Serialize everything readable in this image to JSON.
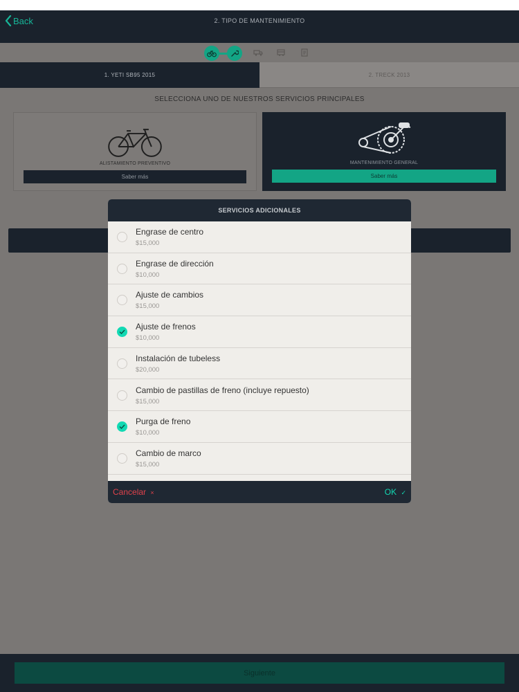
{
  "nav": {
    "back_label": "Back",
    "title": "2. TIPO DE MANTENIMIENTO"
  },
  "steps": {
    "icons": [
      "bike-icon",
      "wrench-icon",
      "truck-icon",
      "delivery-icon",
      "receipt-icon"
    ]
  },
  "bike_tabs": [
    {
      "label": "1. YETI SB95 2015",
      "active": true
    },
    {
      "label": "2. TRECK 2013",
      "active": false
    }
  ],
  "section_title": "SELECCIONA UNO DE NUESTROS SERVICIOS PRINCIPALES",
  "service_cards": [
    {
      "caption": "ALISTAMIENTO PREVENTIVO",
      "button": "Saber más",
      "selected": false
    },
    {
      "caption": "MANTENIMIENTO GENERAL",
      "button": "Saber más",
      "selected": true
    }
  ],
  "modal": {
    "title": "SERVICIOS ADICIONALES",
    "items": [
      {
        "name": "Engrase de centro",
        "price": "$15,000",
        "checked": false
      },
      {
        "name": "Engrase de dirección",
        "price": "$10,000",
        "checked": false
      },
      {
        "name": "Ajuste de cambios",
        "price": "$15,000",
        "checked": false
      },
      {
        "name": "Ajuste de frenos",
        "price": "$10,000",
        "checked": true
      },
      {
        "name": "Instalación de tubeless",
        "price": "$20,000",
        "checked": false
      },
      {
        "name": "Cambio de pastillas de freno (incluye repuesto)",
        "price": "$15,000",
        "checked": false
      },
      {
        "name": "Purga de freno",
        "price": "$10,000",
        "checked": true
      },
      {
        "name": "Cambio de marco",
        "price": "$15,000",
        "checked": false
      }
    ],
    "cancel_label": "Cancelar",
    "cancel_glyph": "×",
    "ok_label": "OK",
    "ok_glyph": "✓"
  },
  "next_label": "Siguiente",
  "colors": {
    "accent": "#13a585",
    "check": "#12d9b3",
    "navy": "#1a222c",
    "cancel": "#e0424b"
  }
}
